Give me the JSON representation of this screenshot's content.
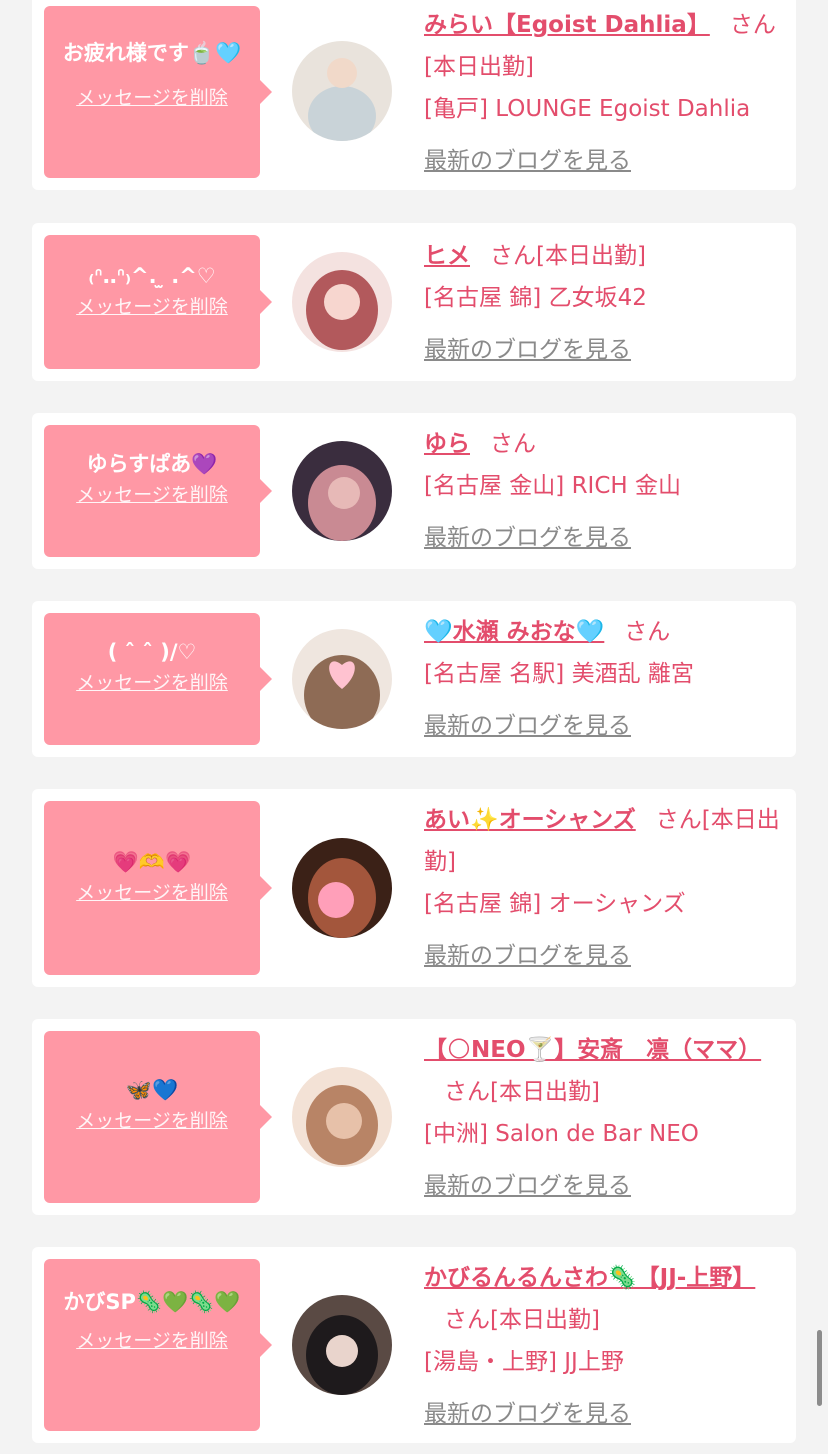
{
  "common": {
    "san": "さん",
    "delete_label": "メッセージを削除",
    "blog_label": "最新のブログを見る"
  },
  "items": [
    {
      "message": "お疲れ様です🍵🩵",
      "name": "みらい【Egoist Dahlia】",
      "status": "[本日出勤]",
      "shop": "[亀戸] LOUNGE Egoist Dahlia",
      "avatar_colors": [
        "#e9e3dc",
        "#c9d3d8",
        "#f1d9c9"
      ]
    },
    {
      "message": "₍ᐢ‥ᐢ₎^. ̫ .^♡",
      "name": "ヒメ",
      "status": "[本日出勤]",
      "shop": "[名古屋 錦] 乙女坂42",
      "avatar_colors": [
        "#f4e2e0",
        "#b2595c",
        "#f7d6cf"
      ]
    },
    {
      "message": "ゆらすぱあ💜",
      "name": "ゆら",
      "status": "",
      "shop": "[名古屋 金山] RICH 金山",
      "avatar_colors": [
        "#3a2d3e",
        "#c98a93",
        "#e7b9b7"
      ]
    },
    {
      "message": "( ˆ ˆ )/♡",
      "name": "🩵水瀬 みおな🩵",
      "status": "",
      "shop": "[名古屋 名駅] 美酒乱 離宮",
      "avatar_colors": [
        "#efe6df",
        "#8e6b55",
        "#ffc2d0"
      ]
    },
    {
      "message": "💗🫶💗",
      "name": "あい✨オーシャンズ",
      "status": "[本日出勤]",
      "shop": "[名古屋 錦] オーシャンズ",
      "avatar_colors": [
        "#3b2117",
        "#a3563c",
        "#ff9fb9"
      ]
    },
    {
      "message": "🦋💙",
      "name": "【🌕NEO🍸】安斎　凛（ママ）",
      "status": "[本日出勤]",
      "shop": "[中洲] Salon de Bar NEO",
      "avatar_colors": [
        "#f3e2d6",
        "#b88466",
        "#e7c1a9"
      ]
    },
    {
      "message": "かびSP🦠💚🦠💚",
      "name": "かびるんるんさわ🦠【JJ-上野】",
      "status": "[本日出勤]",
      "shop": "[湯島・上野] JJ上野",
      "avatar_colors": [
        "#5a4a44",
        "#1e1a1c",
        "#e9d4cc"
      ]
    }
  ],
  "colors": {
    "accent": "#e34d6c",
    "bubble": "#ff98a5",
    "card_bg": "#ffffff",
    "page_bg": "#f3f3f3",
    "link_gray": "#8a8a8a"
  }
}
